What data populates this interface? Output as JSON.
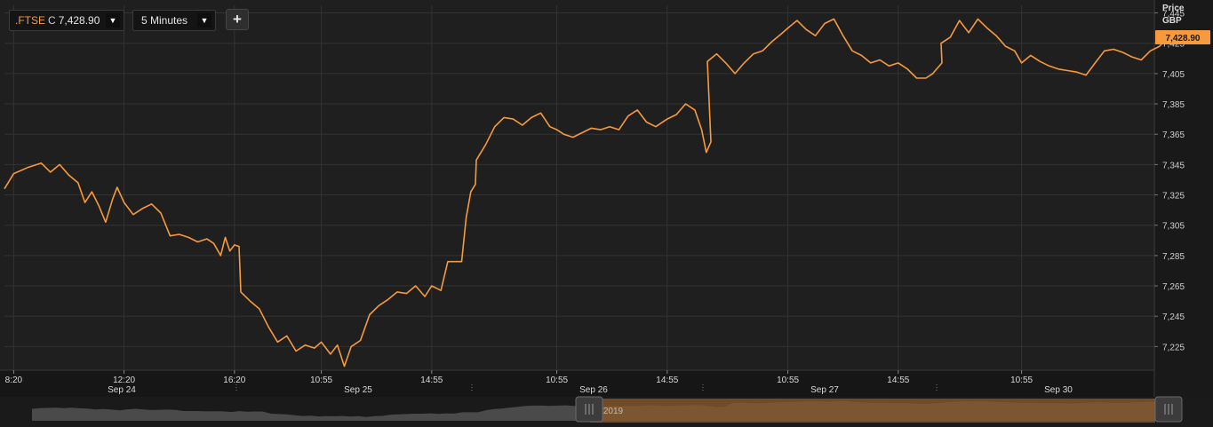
{
  "toolbar": {
    "instrument": {
      "symbol": ".FTSE",
      "close_flag": "C",
      "last": "7,428.90",
      "dropdown_icon": "triangle-down-icon"
    },
    "interval": {
      "label": "5 Minutes",
      "dropdown_icon": "triangle-down-icon"
    },
    "add_label": "+"
  },
  "price_axis": {
    "title": "Price",
    "currency": "GBP"
  },
  "navigator": {
    "label": "2019"
  },
  "colors": {
    "background": "#1f1f1f",
    "grid": "#333333",
    "series": "#f79a3e",
    "badge": "#f79a3e",
    "navigator_selection": "#8a5a2a"
  },
  "chart_data": {
    "type": "line",
    "series": [
      {
        "last_label": "7,428.90",
        "points": [
          [
            "Sep 24 08:00",
            7329
          ],
          [
            "Sep 24 08:20",
            7339
          ],
          [
            "Sep 24 08:50",
            7343
          ],
          [
            "Sep 24 09:20",
            7346
          ],
          [
            "Sep 24 09:40",
            7340
          ],
          [
            "Sep 24 10:00",
            7345
          ],
          [
            "Sep 24 10:20",
            7338
          ],
          [
            "Sep 24 10:40",
            7333
          ],
          [
            "Sep 24 10:55",
            7320
          ],
          [
            "Sep 24 11:10",
            7327
          ],
          [
            "Sep 24 11:25",
            7318
          ],
          [
            "Sep 24 11:40",
            7307
          ],
          [
            "Sep 24 11:55",
            7322
          ],
          [
            "Sep 24 12:05",
            7330
          ],
          [
            "Sep 24 12:20",
            7320
          ],
          [
            "Sep 24 12:40",
            7312
          ],
          [
            "Sep 24 13:00",
            7316
          ],
          [
            "Sep 24 13:20",
            7319
          ],
          [
            "Sep 24 13:40",
            7313
          ],
          [
            "Sep 24 14:00",
            7298
          ],
          [
            "Sep 24 14:20",
            7299
          ],
          [
            "Sep 24 14:40",
            7297
          ],
          [
            "Sep 24 15:00",
            7294
          ],
          [
            "Sep 24 15:20",
            7296
          ],
          [
            "Sep 24 15:35",
            7293
          ],
          [
            "Sep 24 15:50",
            7285
          ],
          [
            "Sep 24 16:00",
            7297
          ],
          [
            "Sep 24 16:10",
            7288
          ],
          [
            "Sep 24 16:20",
            7292
          ],
          [
            "Sep 24 16:30",
            7291
          ],
          [
            "Sep 25 08:00",
            7261
          ],
          [
            "Sep 25 08:20",
            7255
          ],
          [
            "Sep 25 08:40",
            7250
          ],
          [
            "Sep 25 09:00",
            7238
          ],
          [
            "Sep 25 09:20",
            7228
          ],
          [
            "Sep 25 09:40",
            7232
          ],
          [
            "Sep 25 10:00",
            7222
          ],
          [
            "Sep 25 10:20",
            7226
          ],
          [
            "Sep 25 10:40",
            7224
          ],
          [
            "Sep 25 10:55",
            7228
          ],
          [
            "Sep 25 11:15",
            7220
          ],
          [
            "Sep 25 11:30",
            7226
          ],
          [
            "Sep 25 11:45",
            7212
          ],
          [
            "Sep 25 12:00",
            7225
          ],
          [
            "Sep 25 12:20",
            7229
          ],
          [
            "Sep 25 12:40",
            7246
          ],
          [
            "Sep 25 13:00",
            7252
          ],
          [
            "Sep 25 13:20",
            7256
          ],
          [
            "Sep 25 13:40",
            7261
          ],
          [
            "Sep 25 14:00",
            7260
          ],
          [
            "Sep 25 14:20",
            7265
          ],
          [
            "Sep 25 14:40",
            7258
          ],
          [
            "Sep 25 14:55",
            7265
          ],
          [
            "Sep 25 15:15",
            7262
          ],
          [
            "Sep 25 15:30",
            7281
          ],
          [
            "Sep 25 15:45",
            7281
          ],
          [
            "Sep 25 16:00",
            7281
          ],
          [
            "Sep 25 16:10",
            7310
          ],
          [
            "Sep 25 16:20",
            7327
          ],
          [
            "Sep 25 16:30",
            7332
          ],
          [
            "Sep 26 08:00",
            7348
          ],
          [
            "Sep 26 08:20",
            7358
          ],
          [
            "Sep 26 08:40",
            7370
          ],
          [
            "Sep 26 09:00",
            7376
          ],
          [
            "Sep 26 09:20",
            7375
          ],
          [
            "Sep 26 09:40",
            7371
          ],
          [
            "Sep 26 10:00",
            7376
          ],
          [
            "Sep 26 10:20",
            7379
          ],
          [
            "Sep 26 10:40",
            7370
          ],
          [
            "Sep 26 10:55",
            7368
          ],
          [
            "Sep 26 11:10",
            7365
          ],
          [
            "Sep 26 11:30",
            7363
          ],
          [
            "Sep 26 11:50",
            7366
          ],
          [
            "Sep 26 12:10",
            7369
          ],
          [
            "Sep 26 12:30",
            7368
          ],
          [
            "Sep 26 12:50",
            7370
          ],
          [
            "Sep 26 13:10",
            7368
          ],
          [
            "Sep 26 13:30",
            7377
          ],
          [
            "Sep 26 13:50",
            7381
          ],
          [
            "Sep 26 14:10",
            7373
          ],
          [
            "Sep 26 14:30",
            7370
          ],
          [
            "Sep 26 14:55",
            7375
          ],
          [
            "Sep 26 15:15",
            7378
          ],
          [
            "Sep 26 15:35",
            7385
          ],
          [
            "Sep 26 15:55",
            7381
          ],
          [
            "Sep 26 16:10",
            7368
          ],
          [
            "Sep 26 16:20",
            7353
          ],
          [
            "Sep 26 16:30",
            7360
          ],
          [
            "Sep 27 08:00",
            7413
          ],
          [
            "Sep 27 08:20",
            7418
          ],
          [
            "Sep 27 08:40",
            7412
          ],
          [
            "Sep 27 09:00",
            7405
          ],
          [
            "Sep 27 09:20",
            7412
          ],
          [
            "Sep 27 09:40",
            7418
          ],
          [
            "Sep 27 10:00",
            7420
          ],
          [
            "Sep 27 10:20",
            7426
          ],
          [
            "Sep 27 10:40",
            7431
          ],
          [
            "Sep 27 10:55",
            7435
          ],
          [
            "Sep 27 11:15",
            7440
          ],
          [
            "Sep 27 11:35",
            7434
          ],
          [
            "Sep 27 11:55",
            7430
          ],
          [
            "Sep 27 12:15",
            7438
          ],
          [
            "Sep 27 12:35",
            7441
          ],
          [
            "Sep 27 12:55",
            7430
          ],
          [
            "Sep 27 13:15",
            7420
          ],
          [
            "Sep 27 13:35",
            7417
          ],
          [
            "Sep 27 13:55",
            7412
          ],
          [
            "Sep 27 14:15",
            7414
          ],
          [
            "Sep 27 14:35",
            7410
          ],
          [
            "Sep 27 14:55",
            7412
          ],
          [
            "Sep 27 15:15",
            7408
          ],
          [
            "Sep 27 15:35",
            7402
          ],
          [
            "Sep 27 15:55",
            7402
          ],
          [
            "Sep 27 16:10",
            7405
          ],
          [
            "Sep 27 16:30",
            7412
          ],
          [
            "Sep 30 08:00",
            7425
          ],
          [
            "Sep 30 08:20",
            7429
          ],
          [
            "Sep 30 08:40",
            7440
          ],
          [
            "Sep 30 09:00",
            7432
          ],
          [
            "Sep 30 09:20",
            7441
          ],
          [
            "Sep 30 09:40",
            7435
          ],
          [
            "Sep 30 10:00",
            7430
          ],
          [
            "Sep 30 10:20",
            7423
          ],
          [
            "Sep 30 10:40",
            7420
          ],
          [
            "Sep 30 10:55",
            7412
          ],
          [
            "Sep 30 11:15",
            7417
          ],
          [
            "Sep 30 11:35",
            7413
          ],
          [
            "Sep 30 11:55",
            7410
          ],
          [
            "Sep 30 12:15",
            7408
          ],
          [
            "Sep 30 12:35",
            7407
          ],
          [
            "Sep 30 12:55",
            7406
          ],
          [
            "Sep 30 13:15",
            7404
          ],
          [
            "Sep 30 13:35",
            7412
          ],
          [
            "Sep 30 13:55",
            7420
          ],
          [
            "Sep 30 14:15",
            7421
          ],
          [
            "Sep 30 14:35",
            7419
          ],
          [
            "Sep 30 14:55",
            7416
          ],
          [
            "Sep 30 15:15",
            7414
          ],
          [
            "Sep 30 15:35",
            7420
          ],
          [
            "Sep 30 15:55",
            7423
          ],
          [
            "Sep 30 16:15",
            7430
          ],
          [
            "Sep 30 16:30",
            7428.9
          ]
        ]
      }
    ],
    "ylim": [
      7210,
      7450
    ],
    "y_ticks": [
      "7,445",
      "7,425",
      "7,405",
      "7,385",
      "7,365",
      "7,345",
      "7,325",
      "7,305",
      "7,285",
      "7,265",
      "7,245",
      "7,225"
    ],
    "y_tick_values": [
      7445,
      7425,
      7405,
      7385,
      7365,
      7345,
      7325,
      7305,
      7285,
      7265,
      7245,
      7225
    ],
    "x_time_ticks": [
      {
        "label": "8:20",
        "at": "Sep 24 08:20"
      },
      {
        "label": "12:20",
        "at": "Sep 24 12:20"
      },
      {
        "label": "16:20",
        "at": "Sep 24 16:20"
      },
      {
        "label": "10:55",
        "at": "Sep 25 10:55"
      },
      {
        "label": "14:55",
        "at": "Sep 25 14:55"
      },
      {
        "label": "10:55",
        "at": "Sep 26 10:55"
      },
      {
        "label": "14:55",
        "at": "Sep 26 14:55"
      },
      {
        "label": "10:55",
        "at": "Sep 27 10:55"
      },
      {
        "label": "14:55",
        "at": "Sep 27 14:55"
      },
      {
        "label": "10:55",
        "at": "Sep 30 10:55"
      }
    ],
    "x_day_labels": [
      "Sep 24",
      "Sep 25",
      "Sep 26",
      "Sep 27",
      "Sep 30"
    ],
    "grid": true,
    "value_badge": "right"
  }
}
